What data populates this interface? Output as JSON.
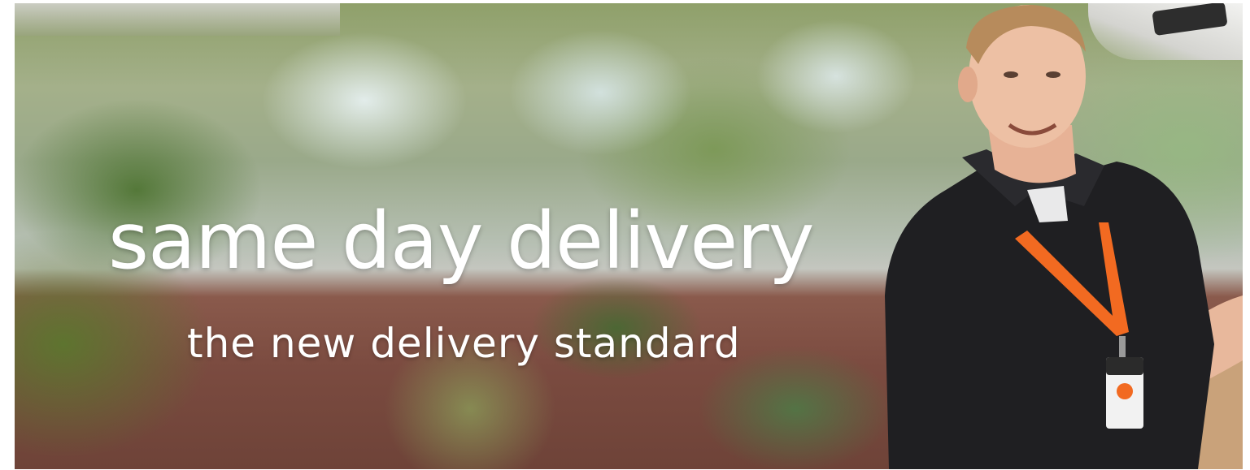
{
  "hero": {
    "headline": "same day delivery",
    "subheadline": "the new delivery standard"
  },
  "colors": {
    "text": "#ffffff",
    "lanyard": "#f26a21",
    "shirt": "#1f1f22"
  }
}
